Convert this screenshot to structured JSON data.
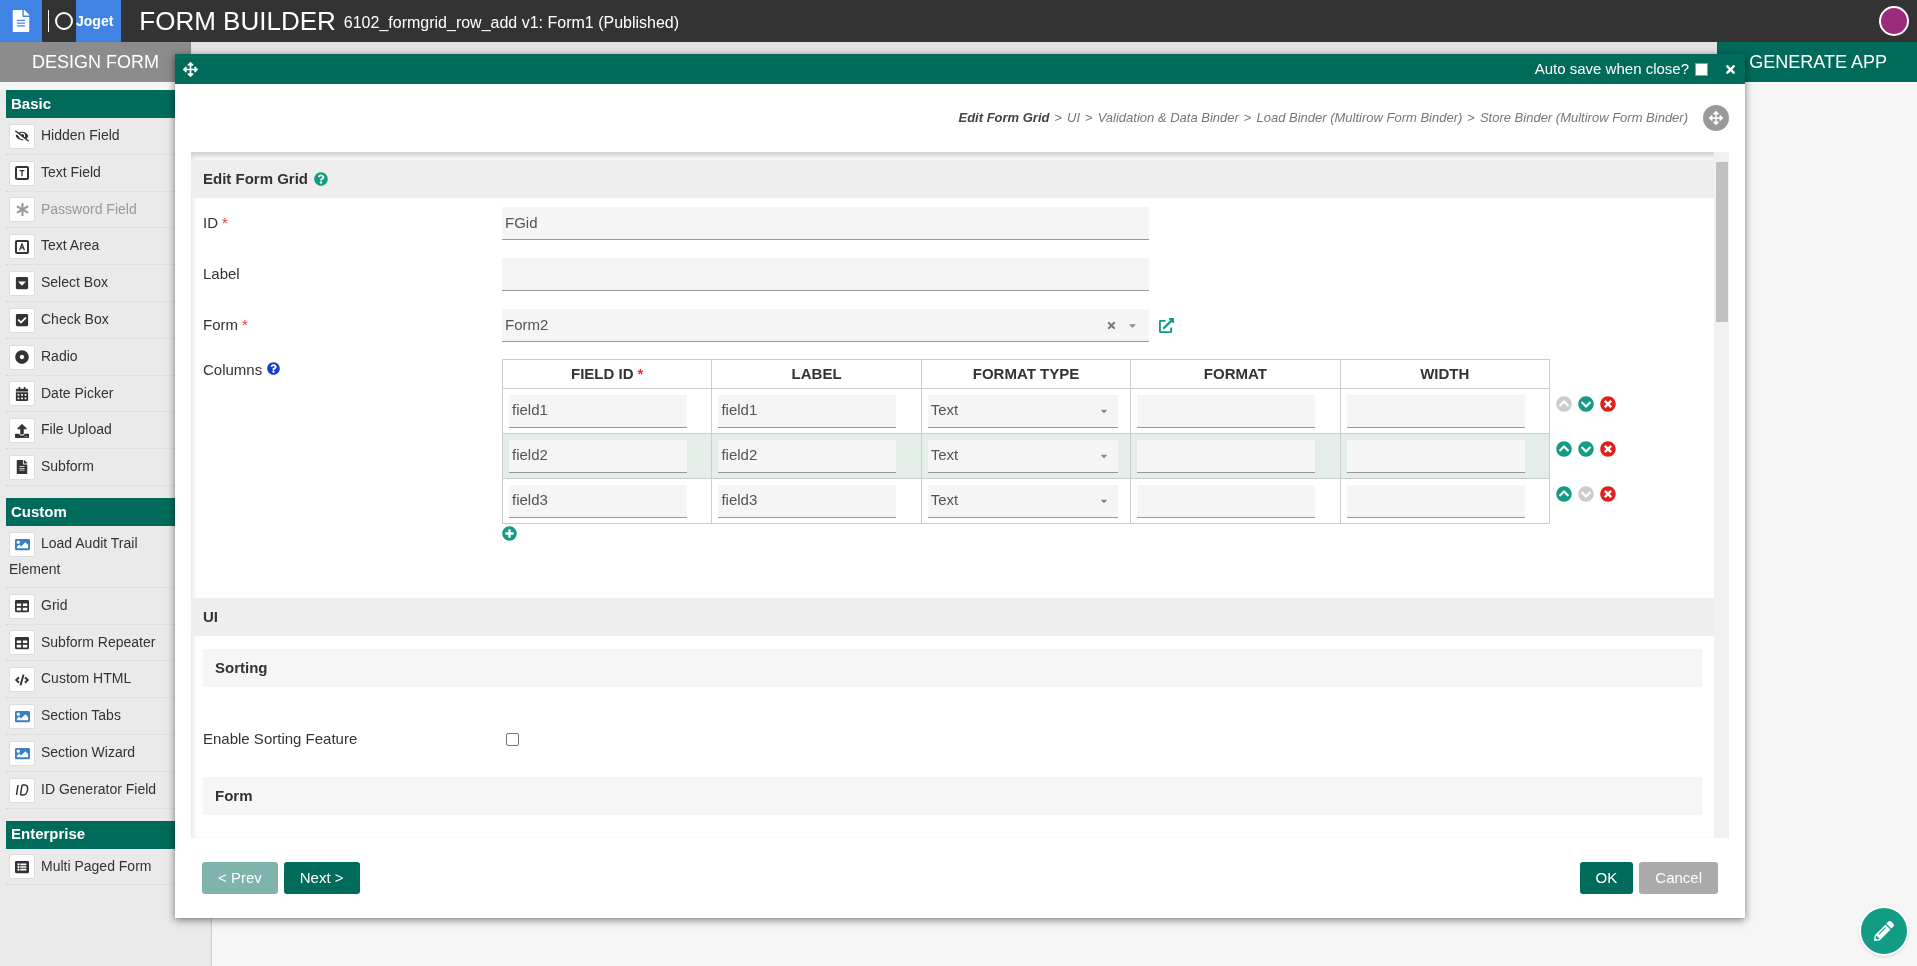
{
  "header": {
    "logo": "Joget",
    "title": "FORM BUILDER",
    "subtitle": "6102_formgrid_row_add v1: Form1 (Published)"
  },
  "tabs": [
    {
      "label": "DESIGN FORM",
      "selected": false
    },
    {
      "label": "GENERATE APP",
      "selected": true
    }
  ],
  "palette": [
    {
      "title": "Basic",
      "items": [
        {
          "label": "Hidden Field",
          "kind": "hidden",
          "disabled": false
        },
        {
          "label": "Text Field",
          "kind": "text",
          "disabled": false
        },
        {
          "label": "Password Field",
          "kind": "password",
          "disabled": true
        },
        {
          "label": "Text Area",
          "kind": "textarea",
          "disabled": false
        },
        {
          "label": "Select Box",
          "kind": "select",
          "disabled": false
        },
        {
          "label": "Check Box",
          "kind": "check",
          "disabled": false
        },
        {
          "label": "Radio",
          "kind": "radio",
          "disabled": false
        },
        {
          "label": "Date Picker",
          "kind": "date",
          "disabled": false
        },
        {
          "label": "File Upload",
          "kind": "upload",
          "disabled": false
        },
        {
          "label": "Subform",
          "kind": "file",
          "disabled": false
        }
      ]
    },
    {
      "title": "Custom",
      "items": [
        {
          "label": "Load Audit Trail Element",
          "kind": "image",
          "disabled": false
        },
        {
          "label": "Grid",
          "kind": "grid",
          "disabled": false
        },
        {
          "label": "Subform Repeater",
          "kind": "grid",
          "disabled": false
        },
        {
          "label": "Custom HTML",
          "kind": "code",
          "disabled": false
        },
        {
          "label": "Section Tabs",
          "kind": "image",
          "disabled": false
        },
        {
          "label": "Section Wizard",
          "kind": "image",
          "disabled": false
        },
        {
          "label": "ID Generator Field",
          "kind": "id",
          "disabled": false
        }
      ]
    },
    {
      "title": "Enterprise",
      "items": [
        {
          "label": "Multi Paged Form",
          "kind": "list",
          "disabled": false
        }
      ]
    }
  ],
  "dialog": {
    "auto_save": {
      "label": "Auto save when close?",
      "checked": false
    },
    "breadcrumb": [
      {
        "label": "Edit Form Grid",
        "selected": true
      },
      {
        "separator": ">",
        "label": "UI",
        "selected": false
      },
      {
        "separator": ">",
        "label": "Validation & Data Binder",
        "selected": false
      },
      {
        "separator": ">",
        "label": "Load Binder (Multirow Form Binder)",
        "selected": false
      },
      {
        "separator": ">",
        "label": "Store Binder (Multirow Form Binder)",
        "selected": false
      }
    ],
    "section_title": "Edit Form Grid",
    "fields": [
      {
        "label": "ID",
        "required_marker": "*",
        "kind": "text",
        "value": "FGid"
      },
      {
        "label": "Label",
        "kind": "text"
      },
      {
        "label": "Form",
        "required_marker": "*",
        "kind": "select",
        "value": "Form2"
      }
    ],
    "columns": {
      "label": "Columns",
      "headers": [
        {
          "label": "FIELD ID",
          "required_marker": "*"
        },
        {
          "label": "LABEL"
        },
        {
          "label": "FORMAT TYPE"
        },
        {
          "label": "FORMAT"
        },
        {
          "label": "WIDTH"
        }
      ],
      "rows": [
        {
          "field_id": "field1",
          "label": "field1",
          "format_type": "Text",
          "highlighted": false,
          "can_move_up": false,
          "can_move_down": true
        },
        {
          "field_id": "field2",
          "label": "field2",
          "format_type": "Text",
          "highlighted": true,
          "can_move_up": true,
          "can_move_down": true
        },
        {
          "field_id": "field3",
          "label": "field3",
          "format_type": "Text",
          "highlighted": false,
          "can_move_up": true,
          "can_move_down": false
        }
      ]
    },
    "ui_title": "UI",
    "sorting_title": "Sorting",
    "sorting": {
      "label": "Enable Sorting Feature",
      "checked": false
    },
    "form_title": "Form",
    "buttons": [
      {
        "label": "< Prev",
        "kind": "prev",
        "disabled": true
      },
      {
        "label": "Next >",
        "kind": "next",
        "disabled": false
      },
      {
        "label": "OK",
        "kind": "ok",
        "disabled": false
      },
      {
        "label": "Cancel",
        "kind": "cancel",
        "disabled": false
      }
    ]
  }
}
